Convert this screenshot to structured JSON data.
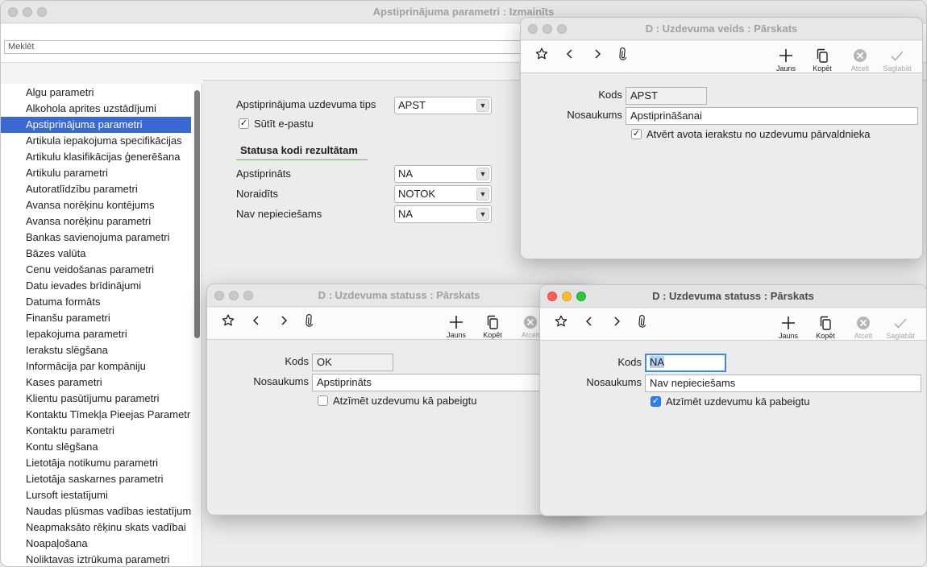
{
  "main": {
    "title": "Apstiprinājuma parametri : Izmainīts",
    "search_placeholder": "Meklēt",
    "sidebar_items": [
      "Algu parametri",
      "Alkohola aprites uzstādījumi",
      "Apstiprinājuma parametri",
      "Artikula iepakojuma specifikācijas",
      "Artikulu klasifikācijas ģenerēšana",
      "Artikulu parametri",
      "Autoratlīdzību parametri",
      "Avansa norēķinu kontējums",
      "Avansa norēķinu parametri",
      "Bankas savienojuma parametri",
      "Bāzes valūta",
      "Cenu veidošanas parametri",
      "Datu ievades brīdinājumi",
      "Datuma formāts",
      "Finanšu parametri",
      "Iepakojuma parametri",
      "Ierakstu slēgšana",
      "Informācija par kompāniju",
      "Kases parametri",
      "Klientu pasūtījumu parametri",
      "Kontaktu Tīmekļa Pieejas Parametri",
      "Kontaktu parametri",
      "Kontu slēgšana",
      "Lietotāja notikumu parametri",
      "Lietotāja saskarnes parametri",
      "Lursoft iestatījumi",
      "Naudas plūsmas vadības iestatījumi",
      "Neapmaksāto rēķinu skats vadībai",
      "Noapaļošana",
      "Noliktavas iztrūkuma parametri"
    ],
    "selected_index": 2,
    "form": {
      "task_type_label": "Apstiprinājuma uzdevuma tips",
      "task_type_value": "APST",
      "send_email_label": "Sūtīt e-pastu",
      "send_email_checked": true,
      "section_title": "Statusa kodi rezultātam",
      "approved_label": "Apstiprināts",
      "approved_value": "NA",
      "rejected_label": "Noraidīts",
      "rejected_value": "NOTOK",
      "not_needed_label": "Nav nepieciešams",
      "not_needed_value": "NA"
    }
  },
  "toolbar_labels": {
    "new": "Jauns",
    "copy": "Kopēt",
    "cancel": "Atcelt",
    "save": "Saglabāt"
  },
  "win_task_type": {
    "title": "D : Uzdevuma veids : Pārskats",
    "code_label": "Kods",
    "code_value": "APST",
    "name_label": "Nosaukums",
    "name_value": "Apstiprināšanai",
    "checkbox_label": "Atvērt avota ierakstu no uzdevumu pārvaldnieka",
    "checkbox_checked": true
  },
  "win_status_ok": {
    "title": "D : Uzdevuma statuss : Pārskats",
    "code_label": "Kods",
    "code_value": "OK",
    "name_label": "Nosaukums",
    "name_value": "Apstiprināts",
    "checkbox_label": "Atzīmēt uzdevumu kā pabeigtu",
    "checkbox_checked": false
  },
  "win_status_na": {
    "title": "D : Uzdevuma statuss : Pārskats",
    "code_label": "Kods",
    "code_value": "NA",
    "name_label": "Nosaukums",
    "name_value": "Nav nepieciešams",
    "checkbox_label": "Atzīmēt uzdevumu kā pabeigtu",
    "checkbox_checked": true
  },
  "icons": {
    "favorite": "star-icon",
    "back": "chevron-left-icon",
    "forward": "chevron-right-icon",
    "attach": "paperclip-icon",
    "new": "plus-icon",
    "copy": "copy-icon",
    "cancel": "cancel-icon",
    "save": "checkmark-icon"
  },
  "colors": {
    "selection": "#3869d4",
    "section_underline": "#5fb24f",
    "focus": "#3d89e6",
    "close": "#ff5f57",
    "minimize": "#febc2e",
    "zoom": "#28c840"
  }
}
